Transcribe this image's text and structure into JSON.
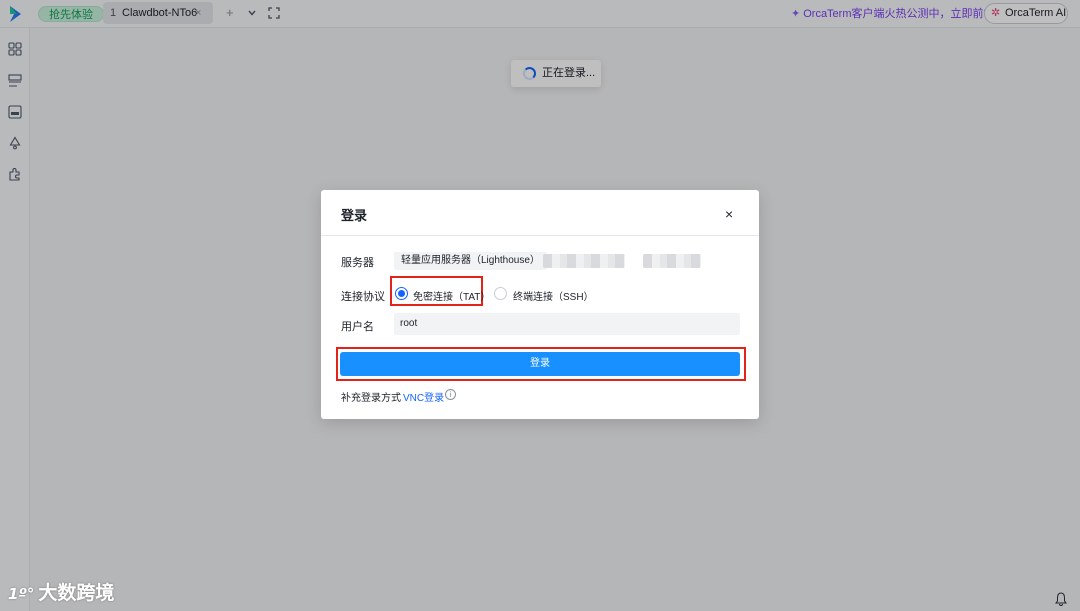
{
  "topbar": {
    "try_badge": "抢先体验",
    "tab": {
      "number": "1",
      "name": "Clawdbot-NTo6",
      "close": "×"
    },
    "add_tab": "+",
    "dropdown": "⌄",
    "fullscreen": "⛶",
    "promo_text": "OrcaTerm客户端火热公测中，立即前往",
    "ai_button": "OrcaTerm AI"
  },
  "toast": {
    "text": "正在登录..."
  },
  "modal": {
    "title": "登录",
    "close": "×",
    "server_label": "服务器",
    "server_value": "轻量应用服务器（Lighthouse）",
    "protocol_label": "连接协议",
    "protocol_options": [
      {
        "label": "免密连接（TAT）",
        "selected": true
      },
      {
        "label": "终端连接（SSH）",
        "selected": false
      }
    ],
    "username_label": "用户名",
    "username_value": "root",
    "login_button": "登录",
    "extra_label": "补充登录方式",
    "vnc_link": "VNC登录",
    "info": "i"
  },
  "watermark": {
    "mark": "1º°",
    "text": "大数跨境"
  },
  "colors": {
    "primary": "#1890ff",
    "highlight": "#e2231a",
    "promo": "#7b3ff2"
  }
}
